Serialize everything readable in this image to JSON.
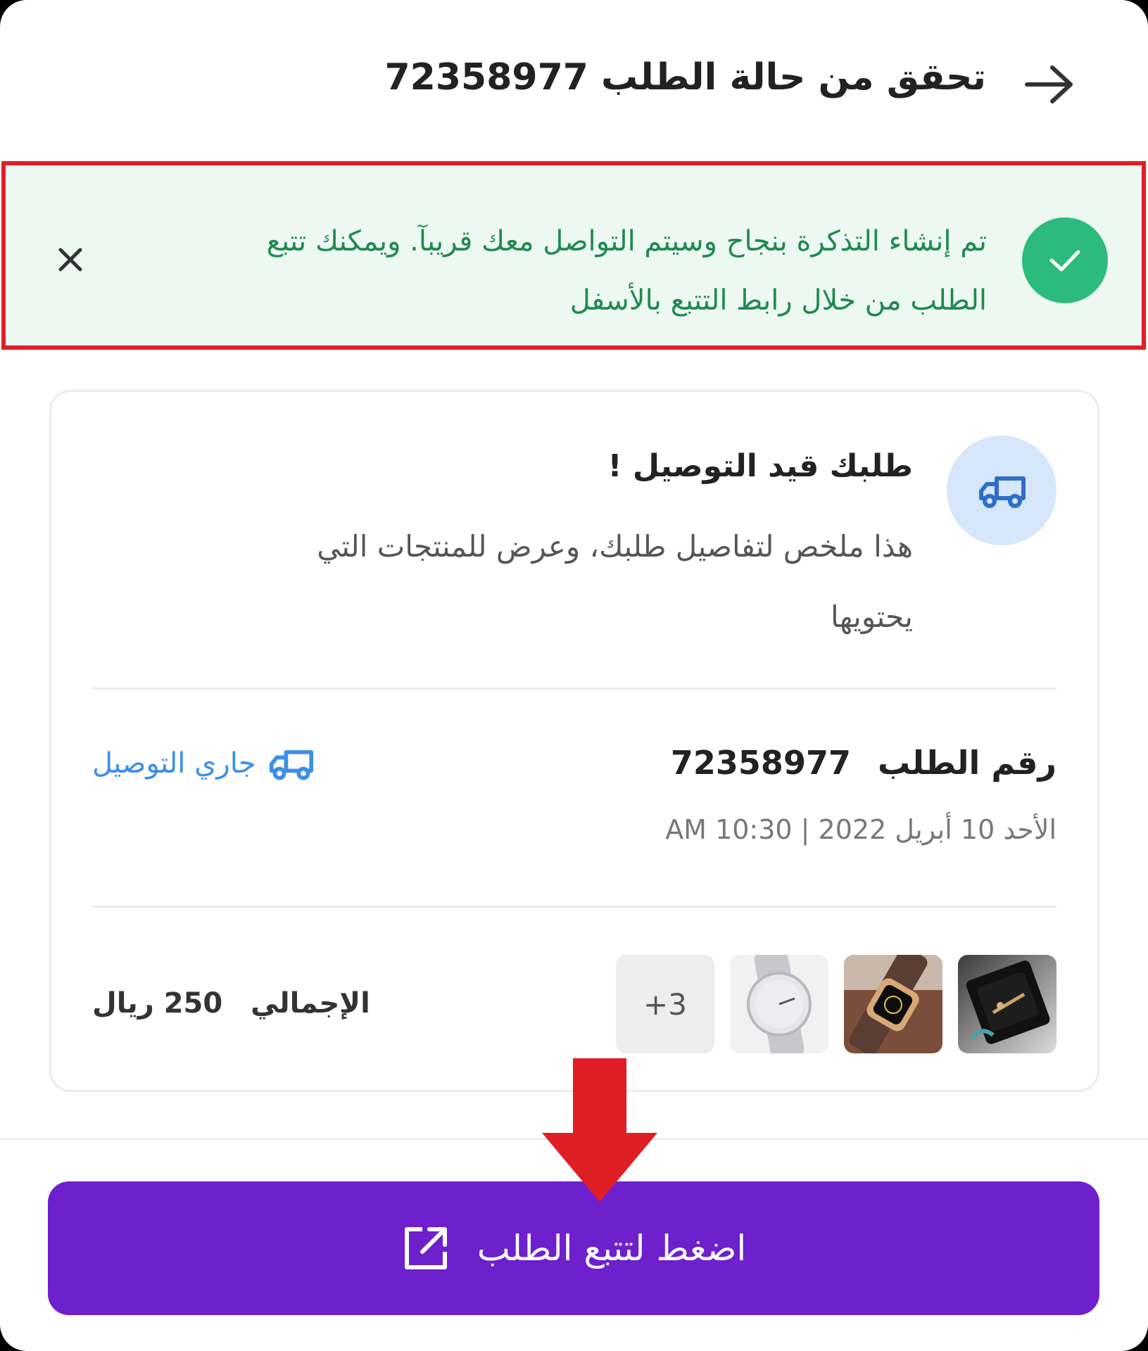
{
  "header": {
    "title": "تحقق من حالة الطلب 72358977"
  },
  "toast": {
    "line1": "تم إنشاء التذكرة بنجاح وسيتم التواصل معك قريبآ. ويمكنك تتبع",
    "line2": "الطلب من خلال رابط التتبع بالأسفل",
    "color": "#2dbb7d"
  },
  "card": {
    "heading": "طلبك قيد التوصيل !",
    "description_line1": "هذا ملخص لتفاصيل طلبك، وعرض للمنتجات التي",
    "description_line2": "يحتويها",
    "order_label": "رقم الطلب",
    "order_number": "72358977",
    "status": "جاري التوصيل",
    "date": "الأحد 10 أبريل 2022 | 10:30 AM",
    "thumbnails": [
      "watch-box-image",
      "smartwatch-image",
      "white-watch-image"
    ],
    "more_count": "+3",
    "total_label": "الإجمالي",
    "total_value": "250 ريال"
  },
  "track_button": {
    "label": "اضغط لتتبع الطلب",
    "color": "#6d20cc"
  },
  "annotation": {
    "highlight_color": "#e01e26"
  }
}
